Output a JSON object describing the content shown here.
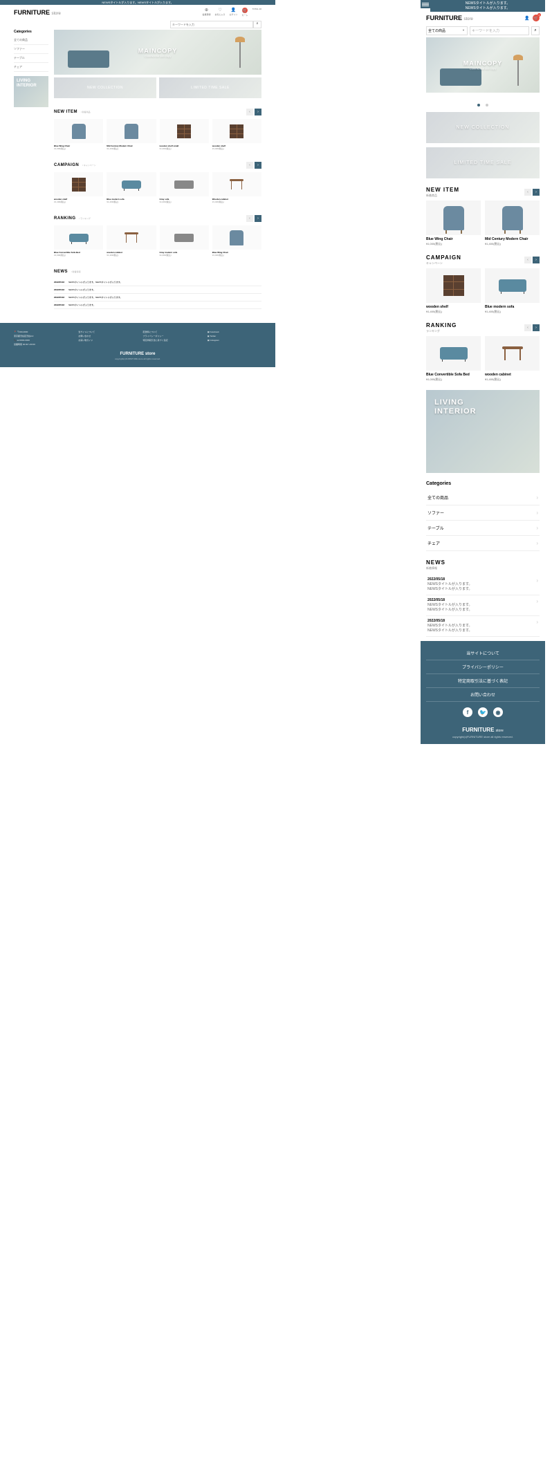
{
  "topbar": {
    "news_line1": "NEWSタイトルが入ります。",
    "news_line2": "NEWSタイトルが入ります。",
    "desktop_news": "NEWSタイトルが入ります。NEWSタイトルが入ります。"
  },
  "logo": {
    "main": "FURNITURE",
    "sub": "store"
  },
  "header_icons": {
    "member": "会員登録",
    "fav": "お気に入り",
    "login": "ログイン",
    "cart": "カート",
    "total": "TOTAL ¥0",
    "cart_count": "0"
  },
  "search": {
    "select": "全ての商品",
    "placeholder": "キーワードを入力"
  },
  "hero": {
    "title": "MAINCOPY",
    "subtitle": "Commercial sub copy"
  },
  "banners": {
    "b1": "NEW COLLECTION",
    "b2": "LIMITED TIME SALE"
  },
  "sections": {
    "newitem": {
      "title": "NEW ITEM",
      "sub": "新着商品"
    },
    "campaign": {
      "title": "CAMPAIGN",
      "sub": "キャンペーン"
    },
    "ranking": {
      "title": "RANKING",
      "sub": "ランキング"
    },
    "news": {
      "title": "NEWS",
      "sub": "新着情報"
    }
  },
  "products": {
    "newitem": [
      {
        "name": "Blue Wing Chair",
        "price": "¥1,000(税込)"
      },
      {
        "name": "Mid Century Modern Chair",
        "price": "¥1,400(税込)"
      },
      {
        "name": "wooden shelf small",
        "price": "¥1,000(税込)"
      },
      {
        "name": "wooden shelf",
        "price": "¥1,400(税込)"
      }
    ],
    "campaign": [
      {
        "name": "wooden shelf",
        "price": "¥1,400(税込)"
      },
      {
        "name": "Blue modern sofa",
        "price": "¥1,400(税込)"
      },
      {
        "name": "Gray sofa",
        "price": "¥1,000(税込)"
      },
      {
        "name": "Wooden cabinet",
        "price": "¥1,400(税込)"
      }
    ],
    "ranking": [
      {
        "name": "Blue Convertible Sofa Bed",
        "price": "¥1,000(税込)"
      },
      {
        "name": "wooden cabinet",
        "price": "¥1,400(税込)"
      },
      {
        "name": "Gray modern sofa",
        "price": "¥1,000(税込)"
      },
      {
        "name": "Blue Wing Chair",
        "price": "¥1,400(税込)"
      }
    ]
  },
  "living": {
    "line1": "LIVING",
    "line2": "INTERIOR"
  },
  "categories": {
    "title": "Categories",
    "items": [
      "全ての商品",
      "ソファー",
      "テーブル",
      "チェア"
    ]
  },
  "news": [
    {
      "date": "2022/05/18",
      "text": "NEWSタイトルが入ります。NEWSタイトルが入ります。"
    },
    {
      "date": "2022/05/18",
      "text": "NEWSタイトルが入ります。NEWSタイトルが入ります。"
    },
    {
      "date": "2022/05/18",
      "text": "NEWSタイトルが入ります。NEWSタイトルが入ります。"
    }
  ],
  "news_d": [
    {
      "date": "2022/05/18",
      "text": "NEWSタイトルが入ります。NEWSタイトルが入ります。"
    },
    {
      "date": "2022/05/18",
      "text": "NEWSタイトルが入ります。"
    },
    {
      "date": "2022/05/18",
      "text": "NEWSタイトルが入ります。NEWSタイトルが入ります。"
    },
    {
      "date": "2022/05/18",
      "text": "NEWSタイトルが入ります。"
    }
  ],
  "footer": {
    "links": [
      "当サイトについて",
      "プライバシーポリシー",
      "特定商取引法に基づく表記",
      "お問い合わせ"
    ],
    "address": {
      "zip": "〒000-0000",
      "addr": "東京都渋谷区渋谷0-0",
      "tel": "tel:0000-0000",
      "hours": "営業時間 00:00〜00:00"
    },
    "col2": [
      "当サイトについて",
      "お問い合わせ",
      "お買い物ガイド"
    ],
    "col3": [
      "配送料について",
      "プライバシーポリシー",
      "特定商取引法に基づく表記"
    ],
    "social": [
      "Facebook",
      "Twitter",
      "Instagram"
    ],
    "copyright": "copyright(c)FURNITURE store all rights reserved."
  },
  "nav_arrows": {
    "prev": "‹",
    "next": "›"
  }
}
